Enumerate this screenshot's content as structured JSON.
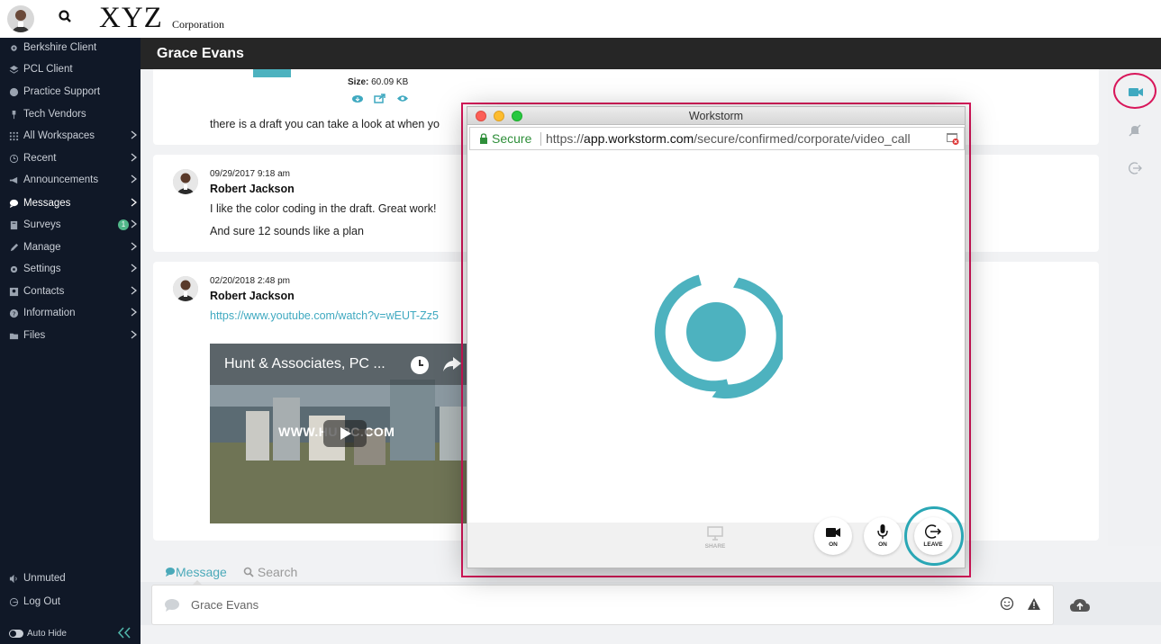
{
  "header": {
    "logo_main": "XYZ",
    "logo_sub": "Corporation",
    "avatar_icon": "user-avatar",
    "search_icon": "search-icon"
  },
  "sidebar": {
    "items": [
      {
        "label": "Berkshire Client",
        "icon": "gear-icon"
      },
      {
        "label": "PCL Client",
        "icon": "stack-icon"
      },
      {
        "label": "Practice Support",
        "icon": "globe-icon"
      },
      {
        "label": "Tech Vendors",
        "icon": "pin-icon"
      },
      {
        "label": "All Workspaces",
        "icon": "grid-icon"
      },
      {
        "label": "Recent",
        "icon": "history-icon"
      },
      {
        "label": "Announcements",
        "icon": "megaphone-icon"
      },
      {
        "label": "Messages",
        "icon": "chat-icon"
      },
      {
        "label": "Surveys",
        "icon": "clipboard-icon"
      },
      {
        "label": "Manage",
        "icon": "pencil-icon"
      },
      {
        "label": "Settings",
        "icon": "gear-icon"
      },
      {
        "label": "Contacts",
        "icon": "contact-card-icon"
      },
      {
        "label": "Information",
        "icon": "question-icon"
      },
      {
        "label": "Files",
        "icon": "folder-icon"
      }
    ],
    "surveys_badge": "1",
    "unmuted_label": "Unmuted",
    "logout_label": "Log Out",
    "autohide_label": "Auto Hide"
  },
  "chat": {
    "title": "Grace Evans",
    "messages": [
      {
        "size_label": "Size:",
        "size_value": "60.09 KB",
        "text": "there is a draft you can take a look at when yo"
      },
      {
        "timestamp": "09/29/2017 9:18 am",
        "author": "Robert Jackson",
        "lines": [
          "I like the color coding in the draft. Great work!",
          "And sure 12 sounds like a plan"
        ]
      },
      {
        "timestamp": "02/20/2018 2:48 pm",
        "author": "Robert Jackson",
        "link": "https://www.youtube.com/watch?v=wEUT-Zz5",
        "video_title": "Hunt & Associates, PC ...",
        "video_overlay": "WWW.HU  PC.COM"
      }
    ]
  },
  "composer": {
    "tab_message": "Message",
    "tab_search": "Search",
    "placeholder": "Grace Evans"
  },
  "popup": {
    "window_title": "Workstorm",
    "secure_label": "Secure",
    "url_scheme": "https://",
    "url_domain": "app.workstorm.com",
    "url_path": "/secure/confirmed/corporate/video_call",
    "controls": {
      "share": "SHARE",
      "camera": "ON",
      "mic": "ON",
      "leave": "LEAVE"
    }
  },
  "colors": {
    "accent": "#4aa9b9",
    "highlight": "#d8165a",
    "sidebar_bg": "#101827",
    "header_bg": "#262626"
  }
}
